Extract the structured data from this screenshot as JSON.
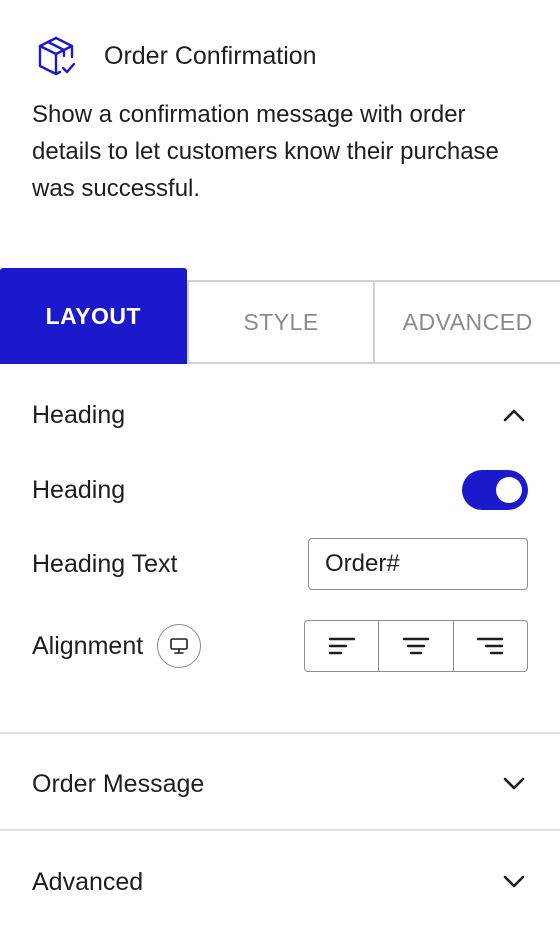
{
  "block": {
    "title": "Order Confirmation",
    "description": "Show a confirmation message with order details to let customers know their purchase was successful.",
    "icon": "package-check-icon",
    "accent_color": "#1a1acc"
  },
  "tabs": [
    {
      "label": "LAYOUT",
      "active": true
    },
    {
      "label": "STYLE",
      "active": false
    },
    {
      "label": "ADVANCED",
      "active": false
    }
  ],
  "sections": {
    "heading": {
      "title": "Heading",
      "expanded": true,
      "toggle_label": "Heading",
      "toggle_on": true,
      "heading_text_label": "Heading Text",
      "heading_text_value": "Order#",
      "alignment_label": "Alignment",
      "alignment_options": [
        "left",
        "center",
        "right"
      ]
    },
    "order_message": {
      "title": "Order Message",
      "expanded": false
    },
    "advanced": {
      "title": "Advanced",
      "expanded": false
    }
  }
}
